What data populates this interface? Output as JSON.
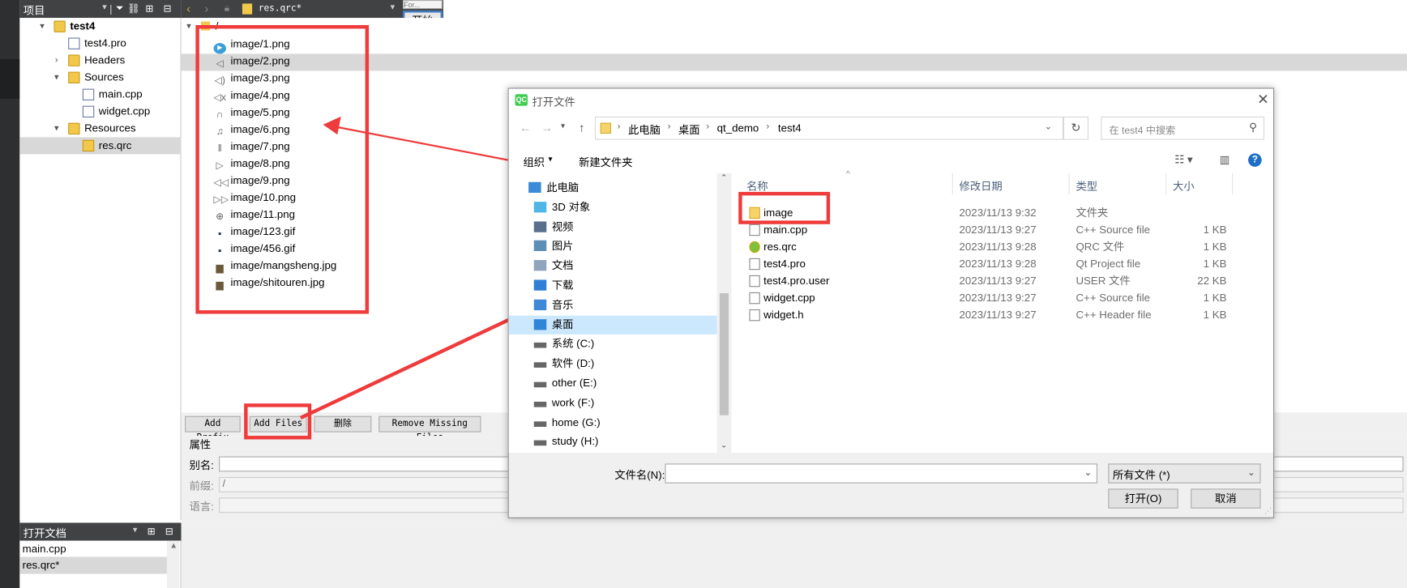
{
  "project_pane": {
    "title": "项目",
    "tree": [
      {
        "label": "test4",
        "level": 0,
        "bold": true,
        "icon": "project-folder-icon",
        "arrow": "▾"
      },
      {
        "label": "test4.pro",
        "level": 1,
        "icon": "pro-file-icon",
        "arrow": ""
      },
      {
        "label": "Headers",
        "level": 1,
        "icon": "headers-folder-icon",
        "arrow": "›"
      },
      {
        "label": "Sources",
        "level": 1,
        "icon": "sources-folder-icon",
        "arrow": "▾"
      },
      {
        "label": "main.cpp",
        "level": 2,
        "icon": "cpp-file-icon",
        "arrow": ""
      },
      {
        "label": "widget.cpp",
        "level": 2,
        "icon": "cpp-file-icon",
        "arrow": ""
      },
      {
        "label": "Resources",
        "level": 1,
        "icon": "resources-folder-icon",
        "arrow": "▾"
      },
      {
        "label": "res.qrc",
        "level": 2,
        "icon": "qrc-file-icon",
        "arrow": "",
        "selected": true
      }
    ]
  },
  "open_docs": {
    "title": "打开文档",
    "items": [
      {
        "label": "main.cpp"
      },
      {
        "label": "res.qrc*",
        "selected": true
      }
    ]
  },
  "editor": {
    "file_tab": "res.qrc*",
    "tiny_label": "For...",
    "start_button": "开始",
    "root_label": "/",
    "resources": [
      {
        "path": "image/1.png",
        "icon": "play-circle-icon"
      },
      {
        "path": "image/2.png",
        "icon": "speaker-icon",
        "selected": true
      },
      {
        "path": "image/3.png",
        "icon": "volume-icon"
      },
      {
        "path": "image/4.png",
        "icon": "mute-icon"
      },
      {
        "path": "image/5.png",
        "icon": "headphones-icon"
      },
      {
        "path": "image/6.png",
        "icon": "music-note-icon"
      },
      {
        "path": "image/7.png",
        "icon": "pause-bar-icon"
      },
      {
        "path": "image/8.png",
        "icon": "play-triangle-icon"
      },
      {
        "path": "image/9.png",
        "icon": "rewind-icon"
      },
      {
        "path": "image/10.png",
        "icon": "fast-forward-icon"
      },
      {
        "path": "image/11.png",
        "icon": "zoom-icon"
      },
      {
        "path": "image/123.gif",
        "icon": "gif-thumbnail-icon"
      },
      {
        "path": "image/456.gif",
        "icon": "gif-thumbnail-icon"
      },
      {
        "path": "image/mangsheng.jpg",
        "icon": "photo-thumbnail-icon"
      },
      {
        "path": "image/shitouren.jpg",
        "icon": "photo-thumbnail-icon"
      }
    ],
    "buttons": {
      "add_prefix": "Add Prefix",
      "add_files": "Add Files",
      "delete": "删除",
      "remove_missing": "Remove Missing Files"
    },
    "properties": {
      "title": "属性",
      "alias_label": "别名:",
      "alias_value": "",
      "prefix_label": "前缀:",
      "prefix_value": "/",
      "lang_label": "语言:",
      "lang_value": ""
    }
  },
  "dialog": {
    "title": "打开文件",
    "breadcrumb": [
      "此电脑",
      "桌面",
      "qt_demo",
      "test4"
    ],
    "search_placeholder": "在 test4 中搜索",
    "organize": "组织",
    "new_folder": "新建文件夹",
    "nav": [
      {
        "label": "此电脑",
        "icon": "pc-icon",
        "indent": 0
      },
      {
        "label": "3D 对象",
        "icon": "cube-icon",
        "indent": 1
      },
      {
        "label": "视频",
        "icon": "video-icon",
        "indent": 1
      },
      {
        "label": "图片",
        "icon": "picture-icon",
        "indent": 1
      },
      {
        "label": "文档",
        "icon": "document-icon",
        "indent": 1
      },
      {
        "label": "下载",
        "icon": "download-icon",
        "indent": 1
      },
      {
        "label": "音乐",
        "icon": "music-icon",
        "indent": 1
      },
      {
        "label": "桌面",
        "icon": "desktop-icon",
        "indent": 1,
        "selected": true
      },
      {
        "label": "系统 (C:)",
        "icon": "drive-icon",
        "indent": 1
      },
      {
        "label": "软件 (D:)",
        "icon": "drive-icon",
        "indent": 1
      },
      {
        "label": "other (E:)",
        "icon": "drive-icon",
        "indent": 1
      },
      {
        "label": "work (F:)",
        "icon": "drive-icon",
        "indent": 1
      },
      {
        "label": "home (G:)",
        "icon": "drive-icon",
        "indent": 1
      },
      {
        "label": "study (H:)",
        "icon": "drive-icon",
        "indent": 1
      }
    ],
    "columns": {
      "name": "名称",
      "date": "修改日期",
      "type": "类型",
      "size": "大小"
    },
    "files": [
      {
        "name": "image",
        "date": "2023/11/13 9:32",
        "type": "文件夹",
        "size": "",
        "icon": "folder-icon"
      },
      {
        "name": "main.cpp",
        "date": "2023/11/13 9:27",
        "type": "C++ Source file",
        "size": "1 KB",
        "icon": "cpp-file-icon"
      },
      {
        "name": "res.qrc",
        "date": "2023/11/13 9:28",
        "type": "QRC 文件",
        "size": "1 KB",
        "icon": "qrc-file-icon"
      },
      {
        "name": "test4.pro",
        "date": "2023/11/13 9:28",
        "type": "Qt Project file",
        "size": "1 KB",
        "icon": "pro-file-icon"
      },
      {
        "name": "test4.pro.user",
        "date": "2023/11/13 9:27",
        "type": "USER 文件",
        "size": "22 KB",
        "icon": "blank-file-icon"
      },
      {
        "name": "widget.cpp",
        "date": "2023/11/13 9:27",
        "type": "C++ Source file",
        "size": "1 KB",
        "icon": "cpp-file-icon"
      },
      {
        "name": "widget.h",
        "date": "2023/11/13 9:27",
        "type": "C++ Header file",
        "size": "1 KB",
        "icon": "header-file-icon"
      }
    ],
    "filename_label": "文件名(N):",
    "filename_value": "",
    "filter": "所有文件 (*)",
    "open_button": "打开(O)",
    "cancel_button": "取消"
  },
  "colors": {
    "annotation_red": "#ef3b3b",
    "ide_dark": "#404244",
    "selection": "#d8d8d8",
    "explorer_selection": "#cce8ff"
  }
}
